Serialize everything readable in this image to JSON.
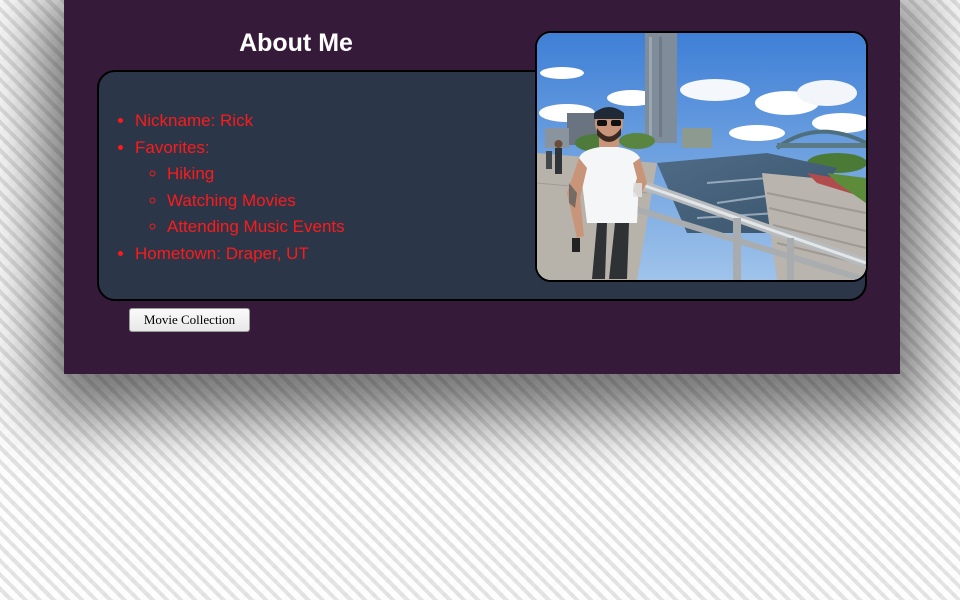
{
  "page": {
    "title": "About Me"
  },
  "about": {
    "items": [
      {
        "label": "Nickname: Rick"
      },
      {
        "label": "Favorites:"
      },
      {
        "label": "Hometown: Draper, UT"
      }
    ],
    "favorites": [
      {
        "label": "Hiking"
      },
      {
        "label": "Watching Movies"
      },
      {
        "label": "Attending Music Events"
      }
    ]
  },
  "photo": {
    "subject": "man-on-bridge-by-river"
  },
  "actions": {
    "movie_collection_label": "Movie Collection"
  },
  "colors": {
    "page_background": "#361a39",
    "panel_background": "#2b3648",
    "list_text": "#ff1a1a",
    "title_text": "#ffffff"
  }
}
